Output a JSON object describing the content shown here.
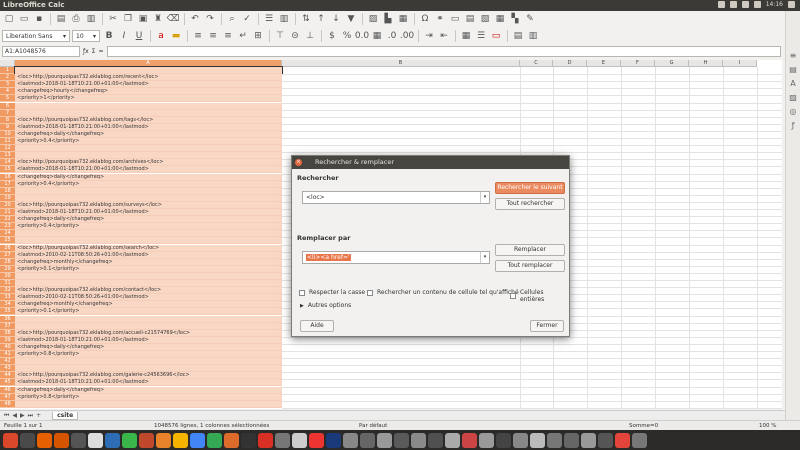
{
  "window": {
    "title": "LibreOffice Calc",
    "clock": "14:16"
  },
  "toolbar2": {
    "font_name": "Liberation Sans",
    "font_size": "10"
  },
  "formula": {
    "name_box": "A1:A1048576"
  },
  "columns": [
    "A",
    "B",
    "C",
    "D",
    "E",
    "F",
    "G",
    "H",
    "I"
  ],
  "rows": [
    {
      "n": "1",
      "t": ""
    },
    {
      "n": "2",
      "t": "<loc>http://pourquoipas732.eklablog.com/recent</loc>"
    },
    {
      "n": "3",
      "t": "<lastmod>2018-01-18T10:21:00+01:00</lastmod>"
    },
    {
      "n": "4",
      "t": "<changefreq>hourly</changefreq>"
    },
    {
      "n": "5",
      "t": "<priority>1</priority>"
    },
    {
      "n": "6",
      "t": ""
    },
    {
      "n": "7",
      "t": ""
    },
    {
      "n": "8",
      "t": "<loc>http://pourquoipas732.eklablog.com/tags</loc>"
    },
    {
      "n": "9",
      "t": "<lastmod>2018-01-18T10:21:00+01:00</lastmod>"
    },
    {
      "n": "10",
      "t": "<changefreq>daily</changefreq>"
    },
    {
      "n": "11",
      "t": "<priority>0.4</priority>"
    },
    {
      "n": "12",
      "t": ""
    },
    {
      "n": "13",
      "t": ""
    },
    {
      "n": "14",
      "t": "<loc>http://pourquoipas732.eklablog.com/archives</loc>"
    },
    {
      "n": "15",
      "t": "<lastmod>2018-01-18T10:21:00+01:00</lastmod>"
    },
    {
      "n": "16",
      "t": "<changefreq>daily</changefreq>"
    },
    {
      "n": "17",
      "t": "<priority>0.4</priority>"
    },
    {
      "n": "18",
      "t": ""
    },
    {
      "n": "19",
      "t": ""
    },
    {
      "n": "20",
      "t": "<loc>http://pourquoipas732.eklablog.com/surveys</loc>"
    },
    {
      "n": "21",
      "t": "<lastmod>2018-01-18T10:21:00+01:00</lastmod>"
    },
    {
      "n": "22",
      "t": "<changefreq>daily</changefreq>"
    },
    {
      "n": "23",
      "t": "<priority>0.4</priority>"
    },
    {
      "n": "24",
      "t": ""
    },
    {
      "n": "25",
      "t": ""
    },
    {
      "n": "26",
      "t": "<loc>http://pourquoipas732.eklablog.com/search</loc>"
    },
    {
      "n": "27",
      "t": "<lastmod>2010-02-11T08:50:26+01:00</lastmod>"
    },
    {
      "n": "28",
      "t": "<changefreq>monthly</changefreq>"
    },
    {
      "n": "29",
      "t": "<priority>0.1</priority>"
    },
    {
      "n": "30",
      "t": ""
    },
    {
      "n": "31",
      "t": ""
    },
    {
      "n": "32",
      "t": "<loc>http://pourquoipas732.eklablog.com/contact</loc>"
    },
    {
      "n": "33",
      "t": "<lastmod>2010-02-11T08:50:26+01:00</lastmod>"
    },
    {
      "n": "34",
      "t": "<changefreq>monthly</changefreq>"
    },
    {
      "n": "35",
      "t": "<priority>0.1</priority>"
    },
    {
      "n": "36",
      "t": ""
    },
    {
      "n": "37",
      "t": ""
    },
    {
      "n": "38",
      "t": "<loc>http://pourquoipas732.eklablog.com/accueil-c21574769</loc>"
    },
    {
      "n": "39",
      "t": "<lastmod>2018-01-18T10:21:00+01:00</lastmod>"
    },
    {
      "n": "40",
      "t": "<changefreq>daily</changefreq>"
    },
    {
      "n": "41",
      "t": "<priority>0.8</priority>"
    },
    {
      "n": "42",
      "t": ""
    },
    {
      "n": "43",
      "t": ""
    },
    {
      "n": "44",
      "t": "<loc>http://pourquoipas732.eklablog.com/galerie-c24563696</loc>"
    },
    {
      "n": "45",
      "t": "<lastmod>2018-01-18T10:21:00+01:00</lastmod>"
    },
    {
      "n": "46",
      "t": "<changefreq>daily</changefreq>"
    },
    {
      "n": "47",
      "t": "<priority>0.8</priority>"
    },
    {
      "n": "48",
      "t": ""
    }
  ],
  "sheet": {
    "tab": "csite"
  },
  "status": {
    "sheet": "Feuille 1 sur 1",
    "selection": "1048576 lignes, 1 colonnes sélectionnées",
    "style": "Par défaut",
    "sum": "Somme=0",
    "zoom": "100 %"
  },
  "dialog": {
    "title": "Rechercher & remplacer",
    "search_label": "Rechercher",
    "search_value": "<loc>",
    "find_next": "Rechercher le suivant",
    "find_all": "Tout rechercher",
    "replace_label": "Remplacer par",
    "replace_value": "<li><a href='",
    "replace": "Remplacer",
    "replace_all": "Tout remplacer",
    "match_case": "Respecter la casse",
    "entire_content": "Rechercher un contenu de cellule tel qu'affiché",
    "entire_cells": "Cellules entières",
    "more_options": "Autres options",
    "help": "Aide",
    "close": "Fermer"
  }
}
